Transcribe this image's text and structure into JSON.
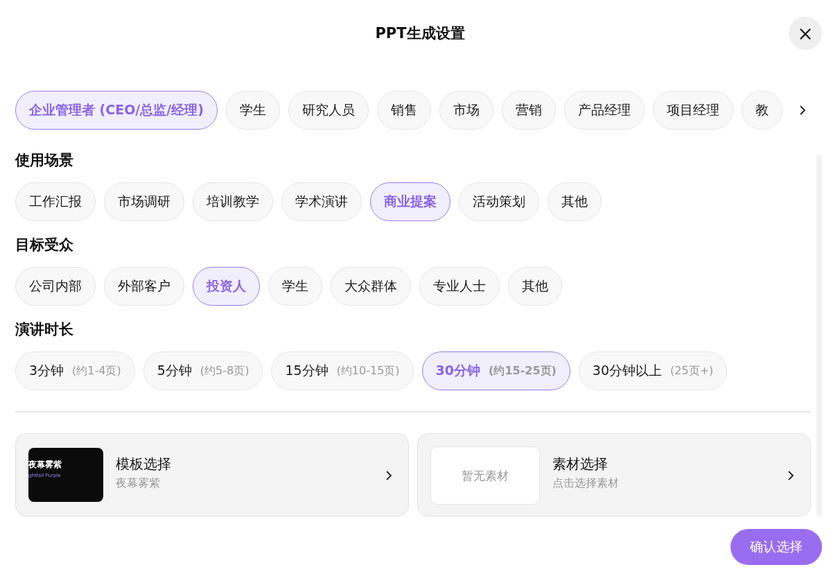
{
  "dialog": {
    "title": "PPT生成设置",
    "close": "×"
  },
  "roles": [
    {
      "label": "企业管理者 (CEO/总监/经理)",
      "selected": true
    },
    {
      "label": "学生",
      "selected": false
    },
    {
      "label": "研究人员",
      "selected": false
    },
    {
      "label": "销售",
      "selected": false
    },
    {
      "label": "市场",
      "selected": false
    },
    {
      "label": "营销",
      "selected": false
    },
    {
      "label": "产品经理",
      "selected": false
    },
    {
      "label": "项目经理",
      "selected": false
    },
    {
      "label": "教",
      "selected": false
    }
  ],
  "sections": [
    {
      "title": "使用场景",
      "options": [
        {
          "label": "工作汇报",
          "selected": false
        },
        {
          "label": "市场调研",
          "selected": false
        },
        {
          "label": "培训教学",
          "selected": false
        },
        {
          "label": "学术演讲",
          "selected": false
        },
        {
          "label": "商业提案",
          "selected": true
        },
        {
          "label": "活动策划",
          "selected": false
        },
        {
          "label": "其他",
          "selected": false
        }
      ]
    },
    {
      "title": "目标受众",
      "options": [
        {
          "label": "公司内部",
          "selected": false
        },
        {
          "label": "外部客户",
          "selected": false
        },
        {
          "label": "投资人",
          "selected": true
        },
        {
          "label": "学生",
          "selected": false
        },
        {
          "label": "大众群体",
          "selected": false
        },
        {
          "label": "专业人士",
          "selected": false
        },
        {
          "label": "其他",
          "selected": false
        }
      ]
    },
    {
      "title": "演讲时长",
      "options": [
        {
          "label": "3分钟",
          "hint": "(约1-4页)",
          "selected": false
        },
        {
          "label": "5分钟",
          "hint": "(约5-8页)",
          "selected": false
        },
        {
          "label": "15分钟",
          "hint": "(约10-15页)",
          "selected": false
        },
        {
          "label": "30分钟",
          "hint": "(约15-25页)",
          "selected": true
        },
        {
          "label": "30分钟以上",
          "hint": "(25页+)",
          "selected": false
        }
      ]
    }
  ],
  "pickers": [
    {
      "kind": "template",
      "title": "模板选择",
      "subtitle": "夜幕雾紫",
      "thumb_title": "夜幕雾紫",
      "thumb_subtitle": "ghtfall Purple"
    },
    {
      "kind": "material",
      "title": "素材选择",
      "subtitle": "点击选择素材",
      "empty": "暂无素材"
    }
  ],
  "confirm": "确认选择"
}
